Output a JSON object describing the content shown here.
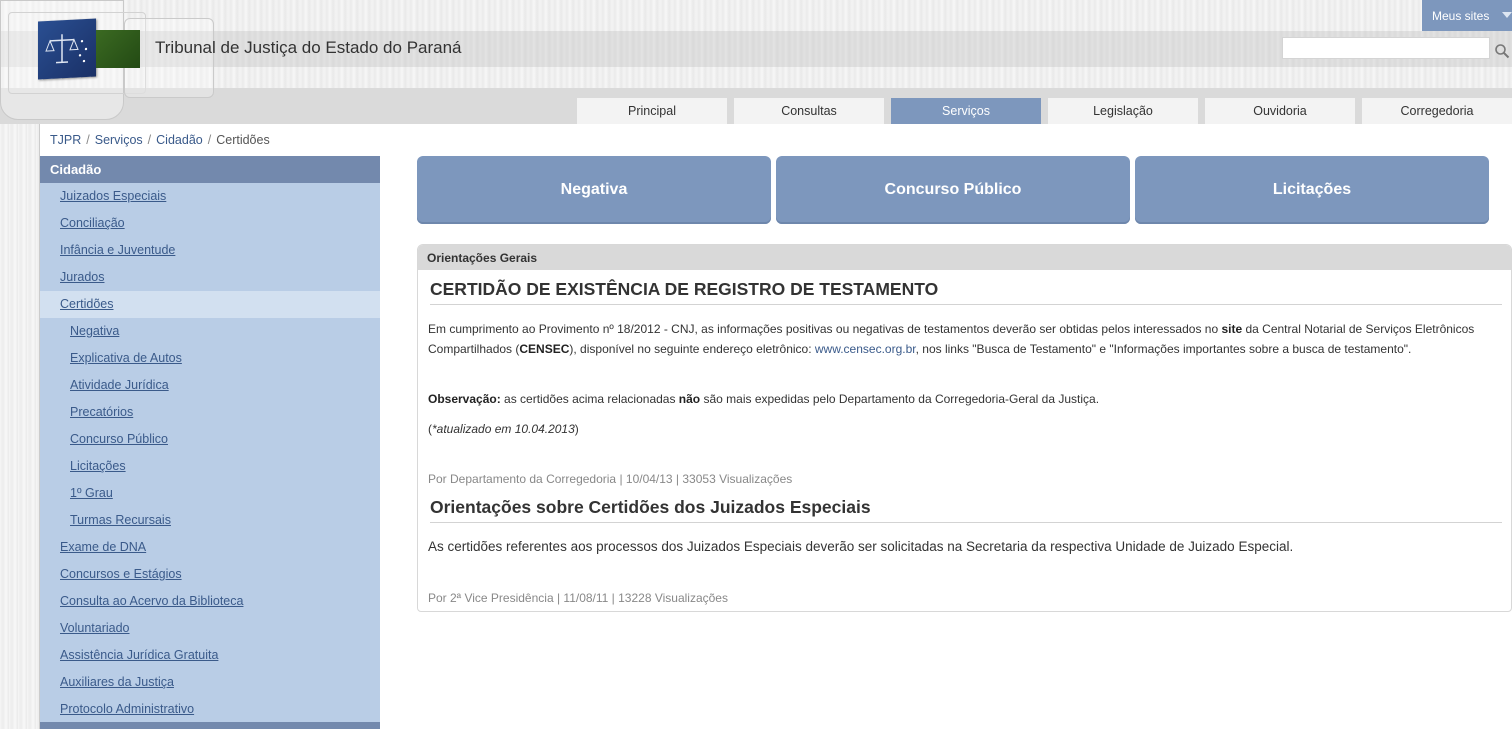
{
  "header": {
    "site_title": "Tribunal de Justiça do Estado do Paraná",
    "meus_sites": "Meus sites",
    "search_placeholder": ""
  },
  "nav": {
    "tabs": [
      {
        "label": "Principal",
        "active": false
      },
      {
        "label": "Consultas",
        "active": false
      },
      {
        "label": "Serviços",
        "active": true
      },
      {
        "label": "Legislação",
        "active": false
      },
      {
        "label": "Ouvidoria",
        "active": false
      },
      {
        "label": "Corregedoria",
        "active": false
      }
    ]
  },
  "breadcrumb": {
    "items": [
      "TJPR",
      "Serviços",
      "Cidadão",
      "Certidões"
    ],
    "separator": "/"
  },
  "sidebar": {
    "title": "Cidadão",
    "items": [
      {
        "label": "Juizados Especiais"
      },
      {
        "label": "Conciliação"
      },
      {
        "label": "Infância e Juventude"
      },
      {
        "label": "Jurados"
      },
      {
        "label": "Certidões",
        "selected": true
      },
      {
        "label": "Negativa",
        "sub": true
      },
      {
        "label": "Explicativa de Autos",
        "sub": true
      },
      {
        "label": "Atividade Jurídica",
        "sub": true
      },
      {
        "label": "Precatórios",
        "sub": true
      },
      {
        "label": "Concurso Público",
        "sub": true
      },
      {
        "label": "Licitações",
        "sub": true
      },
      {
        "label": "1º Grau",
        "sub": true
      },
      {
        "label": "Turmas Recursais",
        "sub": true
      },
      {
        "label": "Exame de DNA"
      },
      {
        "label": "Concursos e Estágios"
      },
      {
        "label": "Consulta ao Acervo da Biblioteca"
      },
      {
        "label": "Voluntariado"
      },
      {
        "label": "Assistência Jurídica Gratuita"
      },
      {
        "label": "Auxiliares da Justiça"
      },
      {
        "label": "Protocolo Administrativo"
      }
    ]
  },
  "tiles": [
    "Negativa",
    "Concurso Público",
    "Licitações"
  ],
  "panel": {
    "header": "Orientações Gerais",
    "article1": {
      "title": "CERTIDÃO DE EXISTÊNCIA DE REGISTRO DE TESTAMENTO",
      "p1_a": "Em cumprimento ao Provimento nº 18/2012 - CNJ, as informações positivas ou negativas de testamentos deverão ser obtidas pelos interessados no ",
      "p1_b": "site",
      "p1_c": " da Central Notarial de Serviços Eletrônicos Compartilhados (",
      "p1_d": "CENSEC",
      "p1_e": "), disponível no seguinte endereço eletrônico: ",
      "p1_link": "www.censec.org.br",
      "p1_f": ", nos links \"Busca de Testamento\" e \"Informações importantes sobre a busca de testamento\".",
      "obs_label": "Observação:",
      "obs_a": " as certidões acima relacionadas ",
      "obs_b": "não",
      "obs_c": " são mais expedidas pelo Departamento da Corregedoria-Geral da Justiça.",
      "updated_open": "(",
      "updated": "*atualizado em 10.04.2013",
      "updated_close": ")",
      "meta": "Por Departamento da Corregedoria | 10/04/13 | 33053 Visualizações"
    },
    "article2": {
      "title": "Orientações sobre Certidões dos Juizados Especiais",
      "text": "As certidões referentes aos processos dos Juizados Especiais deverão ser solicitadas na Secretaria da respectiva Unidade de Juizado Especial.",
      "meta": "Por 2ª Vice Presidência | 11/08/11 | 13228 Visualizações"
    }
  },
  "colors": {
    "accent": "#7d97bd",
    "sidebar_bg": "#b9cde6",
    "sidebar_header": "#7389ad",
    "link": "#3a5a8a"
  }
}
